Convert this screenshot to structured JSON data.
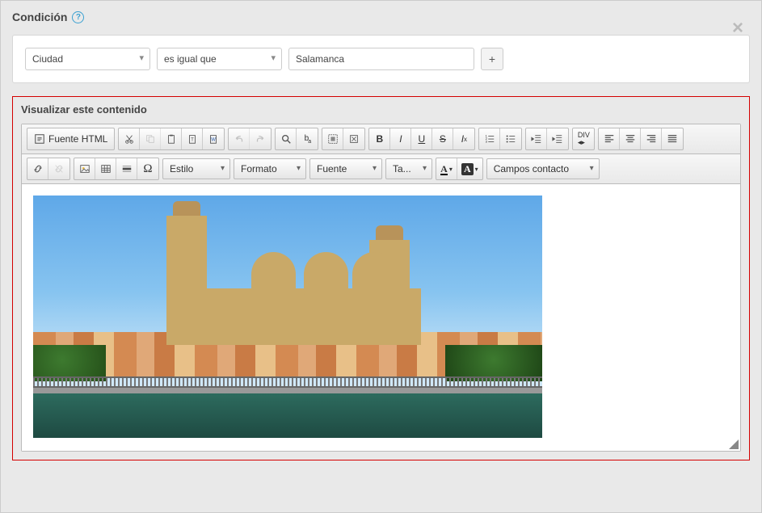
{
  "header": {
    "title": "Condición",
    "help_tooltip": "?"
  },
  "condition": {
    "field_selected": "Ciudad",
    "operator_selected": "es igual que",
    "value": "Salamanca",
    "add_label": "+"
  },
  "content": {
    "heading": "Visualizar este contenido"
  },
  "toolbar": {
    "source": "Fuente HTML",
    "style": "Estilo",
    "format": "Formato",
    "font": "Fuente",
    "size": "Ta...",
    "textcolor": "A",
    "bgcolor": "A",
    "contact_fields": "Campos contacto"
  }
}
